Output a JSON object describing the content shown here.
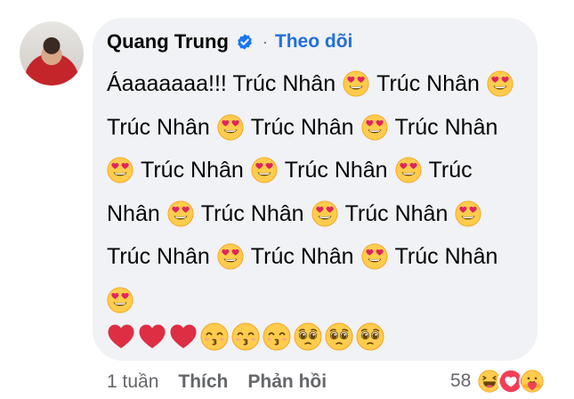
{
  "comment": {
    "author": "Quang Trung",
    "separator": "·",
    "follow_label": "Theo dõi",
    "lines": [
      [
        {
          "t": "Áaaaaaaa!!! Trúc Nhân"
        },
        {
          "e": "heart-eyes"
        },
        {
          "t": "Trúc Nhân"
        },
        {
          "e": "heart-eyes"
        }
      ],
      [
        {
          "t": "Trúc Nhân"
        },
        {
          "e": "heart-eyes"
        },
        {
          "t": "Trúc Nhân"
        },
        {
          "e": "heart-eyes"
        },
        {
          "t": "Trúc Nhân"
        }
      ],
      [
        {
          "e": "heart-eyes"
        },
        {
          "t": "Trúc Nhân"
        },
        {
          "e": "heart-eyes"
        },
        {
          "t": "Trúc Nhân"
        },
        {
          "e": "heart-eyes"
        },
        {
          "t": "Trúc"
        }
      ],
      [
        {
          "t": "Nhân"
        },
        {
          "e": "heart-eyes"
        },
        {
          "t": "Trúc Nhân"
        },
        {
          "e": "heart-eyes"
        },
        {
          "t": "Trúc Nhân"
        },
        {
          "e": "heart-eyes"
        }
      ],
      [
        {
          "t": "Trúc Nhân"
        },
        {
          "e": "heart-eyes"
        },
        {
          "t": "Trúc Nhân"
        },
        {
          "e": "heart-eyes"
        },
        {
          "t": "Trúc Nhân"
        }
      ],
      [
        {
          "e": "heart-eyes"
        }
      ]
    ],
    "emoji_row": [
      "red-heart",
      "red-heart",
      "red-heart",
      "kissing-smiling-eyes",
      "kissing-smiling-eyes",
      "kissing-smiling-eyes",
      "pleading-face",
      "pleading-face",
      "pleading-face"
    ]
  },
  "footer": {
    "time": "1 tuần",
    "like_label": "Thích",
    "reply_label": "Phản hồi",
    "reaction_count": "58",
    "reactions": [
      "haha",
      "love",
      "care"
    ]
  },
  "colors": {
    "link": "#216fdb",
    "bubble": "#f0f2f5",
    "muted": "#65676b"
  }
}
